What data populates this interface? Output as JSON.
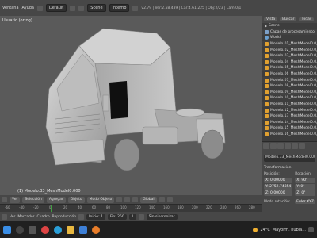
{
  "topbar": {
    "menus": [
      "Ventana",
      "Ayuda"
    ],
    "layout": "Default",
    "scene": "Scene",
    "engine": "Interno",
    "stats": "v2.79 | Ver:2.58.489 | Car:4.61.225 | Obj:2/23 | Lam:0/1"
  },
  "viewport": {
    "label": "Usuario (ortog)",
    "object_label": "(1) Modelo.33_MeshModel0.000"
  },
  "header3d": {
    "buttons": [
      "Ver",
      "Selección",
      "Agregar",
      "Objeto",
      "Modo Objeto",
      "Global"
    ]
  },
  "timeline": {
    "ticks": [
      "-60",
      "-40",
      "-20",
      "0",
      "20",
      "40",
      "60",
      "80",
      "100",
      "120",
      "140",
      "160",
      "180",
      "200",
      "220",
      "240",
      "260",
      "280"
    ],
    "current_frame": 0
  },
  "playbar": {
    "items": [
      "Ver",
      "Marcador",
      "Cuadro",
      "Reproducción"
    ],
    "start": "Inicio: 1",
    "end": "Fin: 250",
    "frame": "1",
    "sync": "Sin sincronizar"
  },
  "outliner": {
    "tabs": [
      "Vista",
      "Buscar",
      "Todas"
    ],
    "rows": [
      "Scene",
      "Capas de procesamiento",
      "World",
      "Modelo.01_MeshModel0.0",
      "Modelo.02_MeshModel0.0",
      "Modelo.03_MeshModel0.0",
      "Modelo.04_MeshModel0.0",
      "Modelo.05_MeshModel0.0",
      "Modelo.06_MeshModel0.0",
      "Modelo.07_MeshModel0.0",
      "Modelo.08_MeshModel0.0",
      "Modelo.09_MeshModel0.0",
      "Modelo.10_MeshModel0.0",
      "Modelo.11_MeshModel0.0",
      "Modelo.12_MeshModel0.0",
      "Modelo.13_MeshModel0.0",
      "Modelo.14_MeshModel0.0",
      "Modelo.15_MeshModel0.0",
      "Modelo.16_MeshModel0.0"
    ]
  },
  "properties": {
    "object_name": "Modelo.33_MeshModel0.000",
    "section": "Transformación",
    "location_label": "Posición:",
    "rotation_label": "Rotación:",
    "location": [
      "X: 0.00000",
      "Y: 2752.74854",
      "Z: 0.00000"
    ],
    "rotation": [
      "X: 90°",
      "Y: 0°",
      "Z: 0°"
    ],
    "mode_label": "Modo rotación:",
    "mode_value": "Euler XYZ"
  },
  "taskbar": {
    "temperature": "24°C",
    "weather": "Mayorm. nubla..."
  },
  "colors": {
    "viewport_bg": "#5a5a5a",
    "accent": "#e0a030",
    "timeline_cursor": "#3f9c3f"
  }
}
